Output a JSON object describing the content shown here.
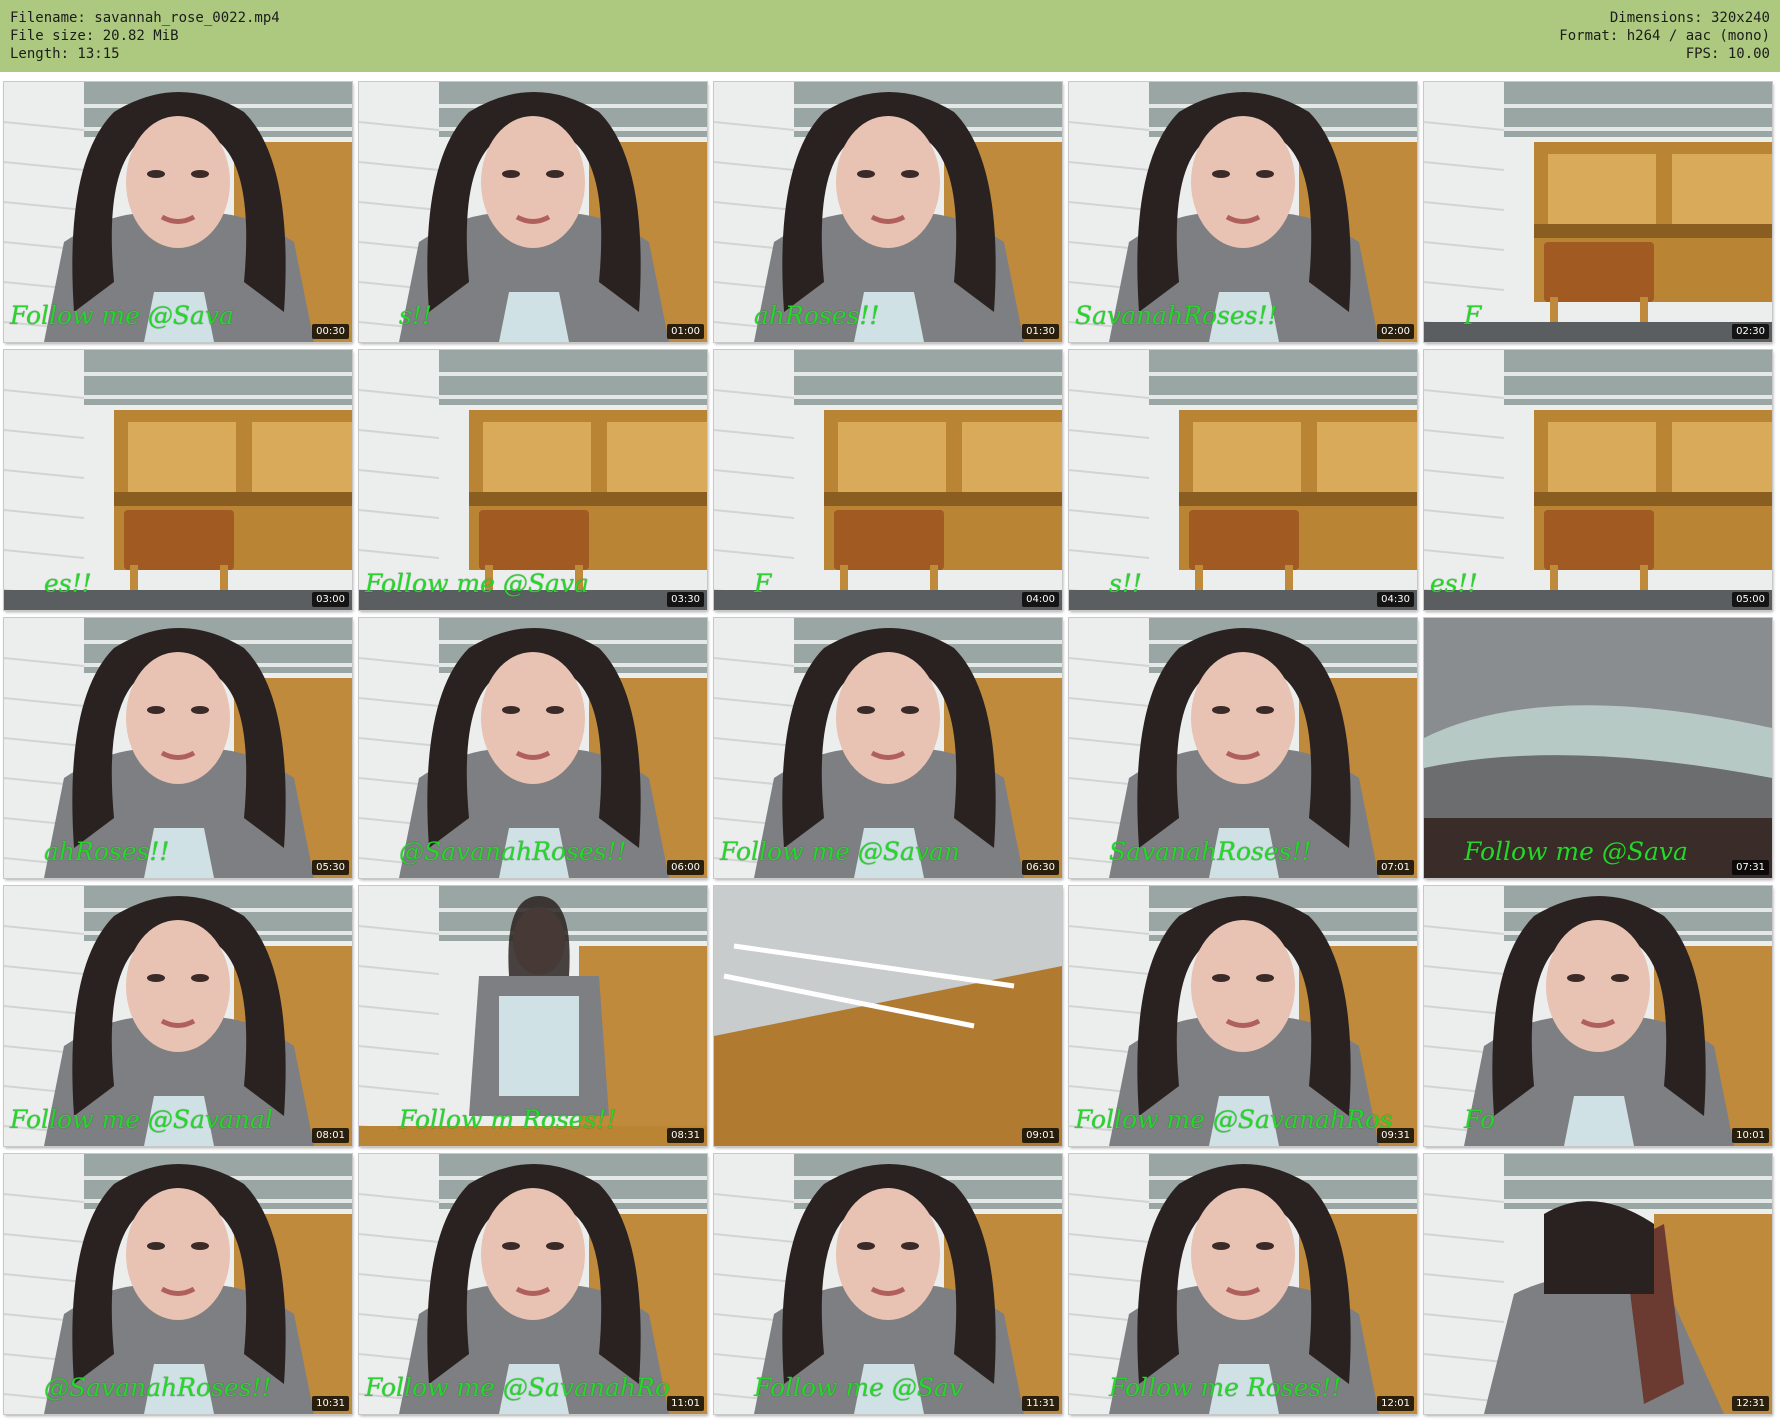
{
  "header": {
    "filename": "Filename: savannah_rose_0022.mp4",
    "filesize": "File size: 20.82 MiB",
    "length": "Length: 13:15",
    "dimensions": "Dimensions: 320x240",
    "format": "Format: h264 / aac (mono)",
    "fps": "FPS: 10.00",
    "background_color": "#adc97f"
  },
  "watermark_color": "#26d62a",
  "thumbnails": [
    {
      "time": "00:30",
      "scene": "face",
      "watermark": "Follow me @Sava"
    },
    {
      "time": "01:00",
      "scene": "face",
      "watermark": "s!!"
    },
    {
      "time": "01:30",
      "scene": "face",
      "watermark": "ahRoses!!"
    },
    {
      "time": "02:00",
      "scene": "face",
      "watermark": "SavanahRoses!!"
    },
    {
      "time": "02:30",
      "scene": "desk",
      "watermark": "F"
    },
    {
      "time": "03:00",
      "scene": "desk",
      "watermark": "es!!"
    },
    {
      "time": "03:30",
      "scene": "desk",
      "watermark": "Follow me @Sava"
    },
    {
      "time": "04:00",
      "scene": "desk",
      "watermark": "F"
    },
    {
      "time": "04:30",
      "scene": "desk",
      "watermark": "s!!"
    },
    {
      "time": "05:00",
      "scene": "desk",
      "watermark": "es!!"
    },
    {
      "time": "05:30",
      "scene": "face",
      "watermark": "ahRoses!!"
    },
    {
      "time": "06:00",
      "scene": "face",
      "watermark": "@SavanahRoses!!"
    },
    {
      "time": "06:30",
      "scene": "face",
      "watermark": "Follow me @Savan"
    },
    {
      "time": "07:01",
      "scene": "face",
      "watermark": "SavanahRoses!!"
    },
    {
      "time": "07:31",
      "scene": "closeup",
      "watermark": "Follow me @Sava"
    },
    {
      "time": "08:01",
      "scene": "face",
      "watermark": "Follow me @Savanal"
    },
    {
      "time": "08:31",
      "scene": "standing",
      "watermark": "Follow m Roses!!"
    },
    {
      "time": "09:01",
      "scene": "ceiling",
      "watermark": ""
    },
    {
      "time": "09:31",
      "scene": "face",
      "watermark": "Follow me @SavanahRos"
    },
    {
      "time": "10:01",
      "scene": "face",
      "watermark": "Fo"
    },
    {
      "time": "10:31",
      "scene": "face",
      "watermark": "@SavanahRoses!!"
    },
    {
      "time": "11:01",
      "scene": "face",
      "watermark": "Follow me @SavanahRo"
    },
    {
      "time": "11:31",
      "scene": "face",
      "watermark": "Follow me @Sav"
    },
    {
      "time": "12:01",
      "scene": "face",
      "watermark": "Follow me Roses!!"
    },
    {
      "time": "12:31",
      "scene": "object",
      "watermark": ""
    }
  ]
}
